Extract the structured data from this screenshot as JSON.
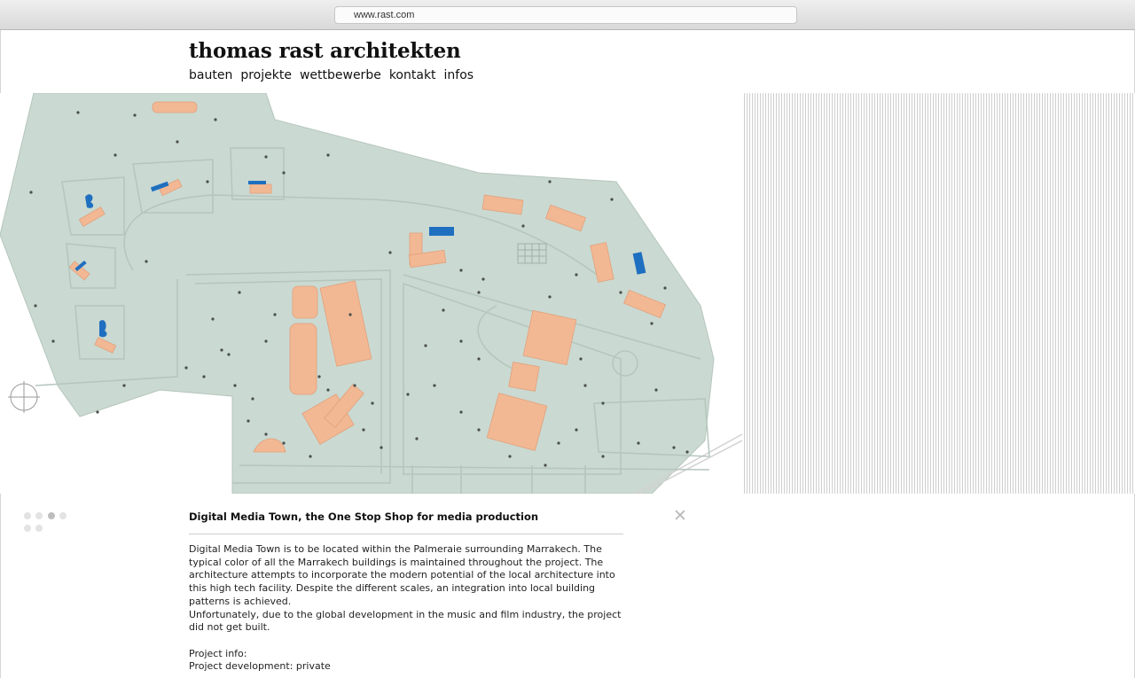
{
  "browser": {
    "url": "www.rast.com"
  },
  "site": {
    "title": "thomas rast architekten",
    "nav": [
      "bauten",
      "projekte",
      "wettbewerbe",
      "kontakt",
      "infos"
    ]
  },
  "slideshow": {
    "count": 6,
    "active_index": 2
  },
  "project": {
    "title": "Digital Media Town, the One Stop Shop for media production",
    "paragraph1": "Digital Media Town is to be located within the Palmeraie surrounding Marrakech. The typical color of all the Marrakech buildings is maintained throughout the project. The architecture attempts to incorporate the modern potential of the local architecture into this high tech facility. Despite the different scales, an integration into local building patterns is achieved.",
    "paragraph2": "Unfortunately, due to the global development in the music and film industry, the project did not get built.",
    "info_heading": "Project info:",
    "info_line1": "Project development: private"
  },
  "colors": {
    "site_fill": "#cad9d1",
    "building_fill": "#f2b894",
    "pool_fill": "#1f6fc0",
    "road_line": "#b5c6bd"
  },
  "icons": {
    "close": "close-icon",
    "north_arrow": "north-arrow-icon"
  }
}
